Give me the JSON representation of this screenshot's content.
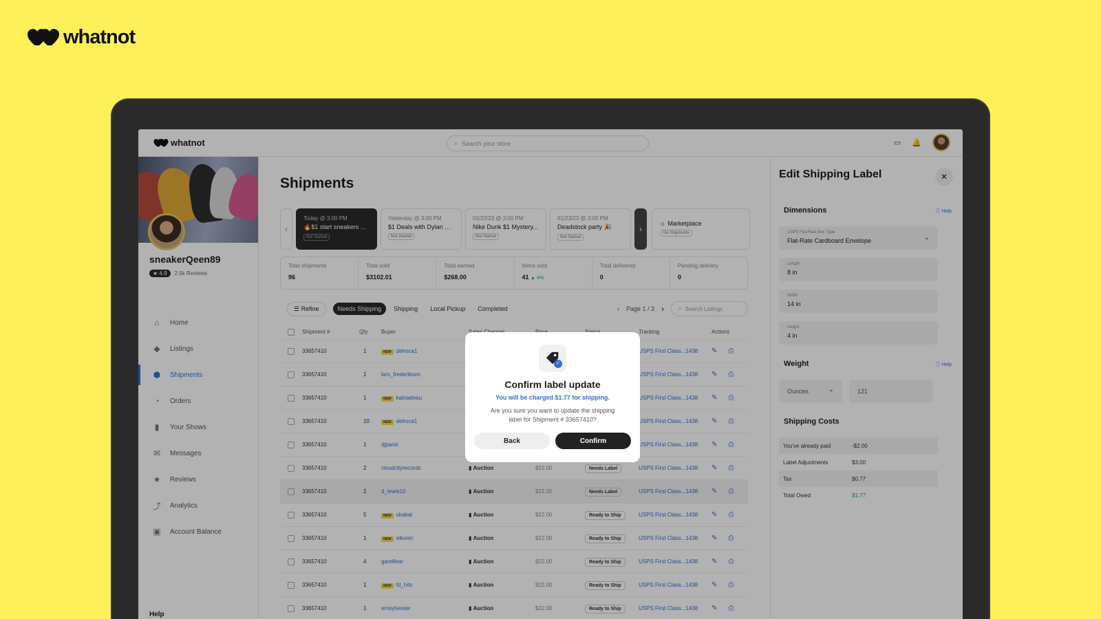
{
  "brand": {
    "name": "whatnot"
  },
  "topbar": {
    "logo_text": "whatnot",
    "search_placeholder": "Search your store"
  },
  "profile": {
    "username": "sneakerQeen89",
    "rating": "4.9",
    "reviews": "2.5k Reviews"
  },
  "sidebar": {
    "items": [
      {
        "label": "Home",
        "icon": "home-icon"
      },
      {
        "label": "Listings",
        "icon": "tag-icon"
      },
      {
        "label": "Shipments",
        "icon": "box-icon",
        "active": true
      },
      {
        "label": "Orders",
        "icon": "orders-icon"
      },
      {
        "label": "Your Shows",
        "icon": "chart-icon"
      },
      {
        "label": "Messages",
        "icon": "mail-icon"
      },
      {
        "label": "Reviews",
        "icon": "star-icon"
      },
      {
        "label": "Analytics",
        "icon": "analytics-icon"
      },
      {
        "label": "Account Balance",
        "icon": "wallet-icon"
      }
    ],
    "help": "Help"
  },
  "main": {
    "title": "Shipments",
    "shows": [
      {
        "time": "Today @ 3:00 PM",
        "title": "🔥$1 start sneakers an...",
        "status": "Not Started"
      },
      {
        "time": "Yesterday @ 3:00 PM",
        "title": "$1 Deals with Dylan Kit...",
        "status": "Not Started"
      },
      {
        "time": "01/22/23 @ 3:00 PM",
        "title": "Nike Dunk $1 Mystery...",
        "status": "Not Started"
      },
      {
        "time": "01/23/23 @ 3:00 PM",
        "title": "Deadstock party 🎉",
        "status": "Not Started"
      }
    ],
    "marketplace": {
      "label": "Marketplace",
      "sub": "No Shipments"
    },
    "stats": [
      {
        "label": "Total shipments",
        "value": "96"
      },
      {
        "label": "Total sold",
        "value": "$3102.01"
      },
      {
        "label": "Total earned",
        "value": "$268.00"
      },
      {
        "label": "Items sold",
        "value": "41",
        "delta": "▲ 4%"
      },
      {
        "label": "Total delivered",
        "value": "0"
      },
      {
        "label": "Pending delivery",
        "value": "0"
      }
    ],
    "filters": {
      "refine": "Refine",
      "tabs": [
        "Needs Shipping",
        "Shipping",
        "Local Pickup",
        "Completed"
      ],
      "page": "Page 1 / 3",
      "search_placeholder": "Search Listings"
    },
    "columns": [
      "Shipment #",
      "Qty",
      "Buyer",
      "Sales Channel",
      "Price",
      "Status",
      "Tracking",
      "Actions"
    ],
    "rows": [
      {
        "id": "33657410",
        "qty": "1",
        "buyer": "delroca1",
        "new": "NEW",
        "channel": "",
        "price": "",
        "status": "",
        "tracking": "USPS First Class...1438"
      },
      {
        "id": "33657410",
        "qty": "1",
        "buyer": "lars_frederiksen",
        "new": "",
        "channel": "",
        "price": "",
        "status": "",
        "tracking": "USPS First Class...1438"
      },
      {
        "id": "33657410",
        "qty": "1",
        "buyer": "katnadeau",
        "new": "NEW",
        "channel": "",
        "price": "",
        "status": "",
        "tracking": "USPS First Class...1438"
      },
      {
        "id": "33657410",
        "qty": "10",
        "buyer": "delroca1",
        "new": "NEW",
        "channel": "",
        "price": "",
        "status": "",
        "tracking": "USPS First Class...1438"
      },
      {
        "id": "33657410",
        "qty": "1",
        "buyer": "djpanic",
        "new": "",
        "channel": "",
        "price": "",
        "status": "",
        "tracking": "USPS First Class...1438"
      },
      {
        "id": "33657410",
        "qty": "2",
        "buyer": "cloudcityrecords",
        "new": "",
        "channel": "Auction",
        "price": "$22.00",
        "status": "Needs Label",
        "tracking": "USPS First Class...1438"
      },
      {
        "id": "33657410",
        "qty": "2",
        "buyer": "d_lewis10",
        "new": "",
        "channel": "Auction",
        "price": "$22.00",
        "status": "Needs Label",
        "tracking": "USPS First Class...1438",
        "highlight": true
      },
      {
        "id": "33657410",
        "qty": "5",
        "buyer": "skabat",
        "new": "NEW",
        "channel": "Auction",
        "price": "$22.00",
        "status": "Ready to Ship",
        "tracking": "USPS First Class...1438"
      },
      {
        "id": "33657410",
        "qty": "1",
        "buyer": "eikonic",
        "new": "NEW",
        "channel": "Auction",
        "price": "$22.00",
        "status": "Ready to Ship",
        "tracking": "USPS First Class...1438"
      },
      {
        "id": "33657410",
        "qty": "4",
        "buyer": "gare8ear",
        "new": "",
        "channel": "Auction",
        "price": "$22.00",
        "status": "Ready to Ship",
        "tracking": "USPS First Class...1438"
      },
      {
        "id": "33657410",
        "qty": "1",
        "buyer": "fd_hits",
        "new": "NEW",
        "channel": "Auction",
        "price": "$22.00",
        "status": "Ready to Ship",
        "tracking": "USPS First Class...1438"
      },
      {
        "id": "33657410",
        "qty": "1",
        "buyer": "emsylvester",
        "new": "",
        "channel": "Auction",
        "price": "$22.00",
        "status": "Ready to Ship",
        "tracking": "USPS First Class...1438"
      }
    ]
  },
  "panel": {
    "title": "Edit Shipping Label",
    "dimensions": {
      "heading": "Dimensions",
      "help": "Help",
      "box_type_label": "USPS Flat-Rate Box Type",
      "box_type_value": "Flat-Rate Cardboard Envelope",
      "length_label": "Length",
      "length_value": "8 in",
      "width_label": "Width",
      "width_value": "14 in",
      "height_label": "Height",
      "height_value": "4 in"
    },
    "weight": {
      "heading": "Weight",
      "help": "Help",
      "unit": "Ounces",
      "value": "121"
    },
    "costs": {
      "heading": "Shipping Costs",
      "rows": [
        {
          "label": "You've already paid",
          "value": "-$2.00"
        },
        {
          "label": "Label Adjustments",
          "value": "$3.00"
        },
        {
          "label": "Tax",
          "value": "$0.77"
        },
        {
          "label": "Total Owed",
          "value": "$1.77"
        }
      ]
    }
  },
  "modal": {
    "title": "Confirm label update",
    "charge": "You will be charged $1.77 for shipping.",
    "body": "Are you sure you want to update the shipping label for Shipment # 33657410?",
    "back": "Back",
    "confirm": "Confirm"
  },
  "colors": {
    "background": "#fdf05a",
    "accent": "#2d6fd6",
    "dark": "#222222",
    "green": "#2aa36a"
  }
}
